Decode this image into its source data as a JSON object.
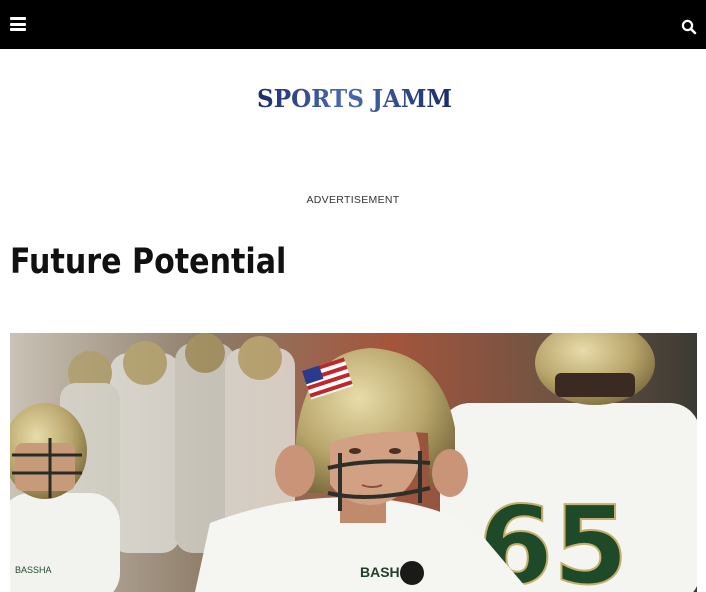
{
  "header": {
    "menu_icon": "hamburger-menu-icon",
    "search_icon": "search-icon",
    "background": "#000000"
  },
  "logo": {
    "text": "SPORTS JAMM",
    "color_start": "#1a2a6c",
    "color_end": "#3d5fa8"
  },
  "ad": {
    "label": "ADVERTISEMENT"
  },
  "article": {
    "title": "Future Potential"
  },
  "hero_image": {
    "alt": "Football players in white and green jerseys with gold helmets; one player adjusts her helmet"
  }
}
